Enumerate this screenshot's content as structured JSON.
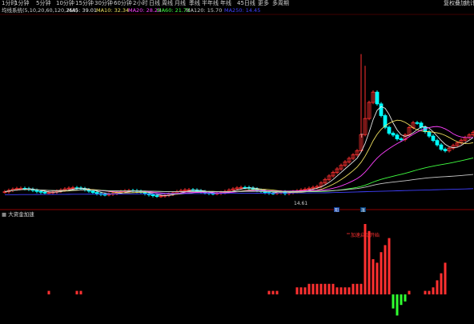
{
  "toolbar": {
    "periods": [
      "1分时",
      "1分钟",
      "5分钟",
      "10分钟",
      "15分钟",
      "30分钟",
      "60分钟",
      "2小时",
      "日线",
      "周线",
      "月线",
      "季线",
      "半年线",
      "年线",
      "45日线",
      "更多",
      "多周期"
    ],
    "right": [
      "复权",
      "叠加",
      "统计"
    ]
  },
  "ma_legend": {
    "indicator": "均线系统(5,10,20,60,120,250)",
    "items": [
      {
        "label": "MA5: 39.01",
        "color": "#e8e8e8"
      },
      {
        "label": "MA10: 32.34",
        "color": "#f0e060"
      },
      {
        "label": "MA20: 28.23",
        "color": "#ff40ff"
      },
      {
        "label": "MA60: 21.71",
        "color": "#40ff40"
      },
      {
        "label": "MA120: 15.70",
        "color": "#c8c8c8"
      },
      {
        "label": "MA250: 14.45",
        "color": "#4040ff"
      }
    ]
  },
  "markers": {
    "low_label": "14.61",
    "peak_label": "T",
    "date_tags": [
      "阳",
      "涨"
    ]
  },
  "sub_chart": {
    "title": "大资金加速",
    "annotation": "加速启动开始"
  },
  "colors": {
    "up": "#ff3030",
    "down": "#00ffff",
    "green": "#30ff30",
    "ma5": "#e8e8e8",
    "ma10": "#f0e060",
    "ma20": "#ff40ff",
    "ma60": "#40ff40",
    "ma120": "#c8c8c8",
    "ma250": "#4040ff"
  },
  "chart_data": [
    {
      "type": "candlestick",
      "title": "",
      "series": [
        {
          "name": "MA5",
          "values": []
        },
        {
          "name": "MA10",
          "values": []
        },
        {
          "name": "MA20",
          "values": []
        },
        {
          "name": "MA60",
          "values": []
        },
        {
          "name": "MA120",
          "values": []
        },
        {
          "name": "MA250",
          "values": []
        }
      ]
    },
    {
      "type": "bar",
      "title": "大资金加速",
      "values": [
        0,
        0,
        0,
        0,
        0,
        0,
        0,
        0,
        0,
        0,
        0,
        1,
        0,
        0,
        0,
        0,
        0,
        0,
        1,
        1,
        0,
        0,
        0,
        0,
        0,
        0,
        0,
        0,
        0,
        0,
        0,
        0,
        0,
        0,
        0,
        0,
        0,
        0,
        0,
        0,
        0,
        0,
        0,
        0,
        0,
        0,
        0,
        0,
        0,
        0,
        0,
        0,
        0,
        0,
        0,
        0,
        0,
        0,
        0,
        0,
        0,
        0,
        0,
        0,
        0,
        0,
        1,
        1,
        1,
        0,
        0,
        0,
        0,
        2,
        2,
        2,
        3,
        3,
        3,
        3,
        3,
        3,
        3,
        2,
        2,
        2,
        2,
        3,
        3,
        3,
        20,
        18,
        10,
        9,
        12,
        14,
        16,
        -4,
        -6,
        -3,
        -2,
        1,
        0,
        0,
        0,
        1,
        1,
        2,
        4,
        6,
        9
      ]
    }
  ]
}
